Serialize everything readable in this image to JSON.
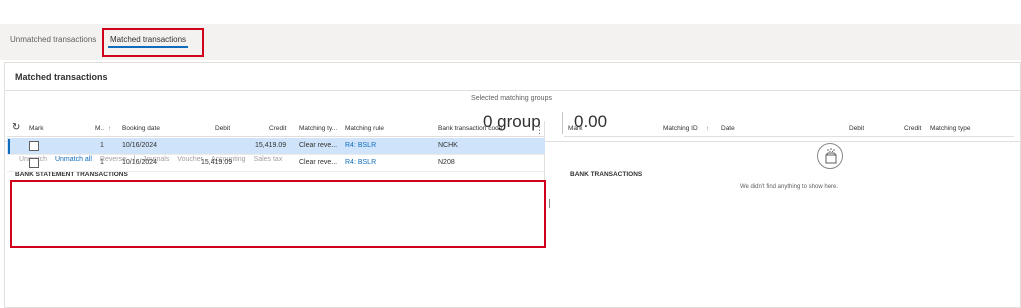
{
  "tabs": {
    "unmatched": "Unmatched transactions",
    "matched": "Matched transactions"
  },
  "panel": {
    "title": "Matched transactions"
  },
  "summary": {
    "label": "Selected matching groups",
    "groups": "0 group",
    "amount": "0.00"
  },
  "toolbar": {
    "unmatch": "Unmatch",
    "unmatch_all": "Unmatch all",
    "reverse": "Reverse",
    "journals": "Journals",
    "voucher": "Voucher",
    "accounting": "Accounting",
    "sales_tax": "Sales tax"
  },
  "bank_statement": {
    "title": "BANK STATEMENT TRANSACTIONS",
    "columns": {
      "mark": "Mark",
      "m": "M..",
      "sort": "↑",
      "booking_date": "Booking date",
      "debit": "Debit",
      "credit": "Credit",
      "matching_type": "Matching ty...",
      "matching_rule": "Matching rule",
      "bank_code": "Bank transaction code"
    },
    "rows": [
      {
        "m": "1",
        "booking_date": "10/16/2024",
        "debit": "",
        "credit": "15,419.09",
        "matching_type": "Clear reve...",
        "matching_rule": "R4: BSLR",
        "bank_code": "NCHK"
      },
      {
        "m": "1",
        "booking_date": "10/16/2024",
        "debit": "15,419.09",
        "credit": "",
        "matching_type": "Clear reve...",
        "matching_rule": "R4: BSLR",
        "bank_code": "N208"
      }
    ]
  },
  "bank_transactions": {
    "title": "BANK TRANSACTIONS",
    "columns": {
      "mark": "Mark",
      "matching_id": "Matching ID",
      "sort": "↑",
      "date": "Date",
      "debit": "Debit",
      "credit": "Credit",
      "matching_type": "Matching type"
    },
    "empty_message": "We didn't find anything to show here."
  },
  "colors": {
    "accent": "#0f6cbd",
    "selected_row": "#cfe4fa",
    "highlight_box": "#d0021b"
  },
  "icons": [
    "refresh-icon",
    "more-icon",
    "empty-state-icon"
  ]
}
